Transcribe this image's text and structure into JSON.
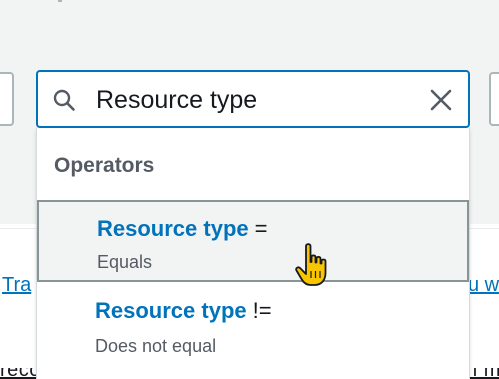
{
  "search": {
    "value": "Resource type"
  },
  "dropdown": {
    "header": "Operators",
    "options": [
      {
        "attribute": "Resource type",
        "operator": "=",
        "description": "Equals"
      },
      {
        "attribute": "Resource type",
        "operator": "!=",
        "description": "Does not equal"
      }
    ]
  },
  "background": {
    "left_link_fragment": "Tra",
    "right_link_fragment": "u w"
  },
  "colors": {
    "focus_border": "#0073bb",
    "link_blue": "#0073bb",
    "highlight_bg": "#f2f3f3",
    "highlight_border": "#879596",
    "cursor_fill": "#f9c500"
  },
  "icons": {
    "search": "search-icon",
    "clear": "close-icon",
    "pointer": "hand-pointer-icon"
  }
}
